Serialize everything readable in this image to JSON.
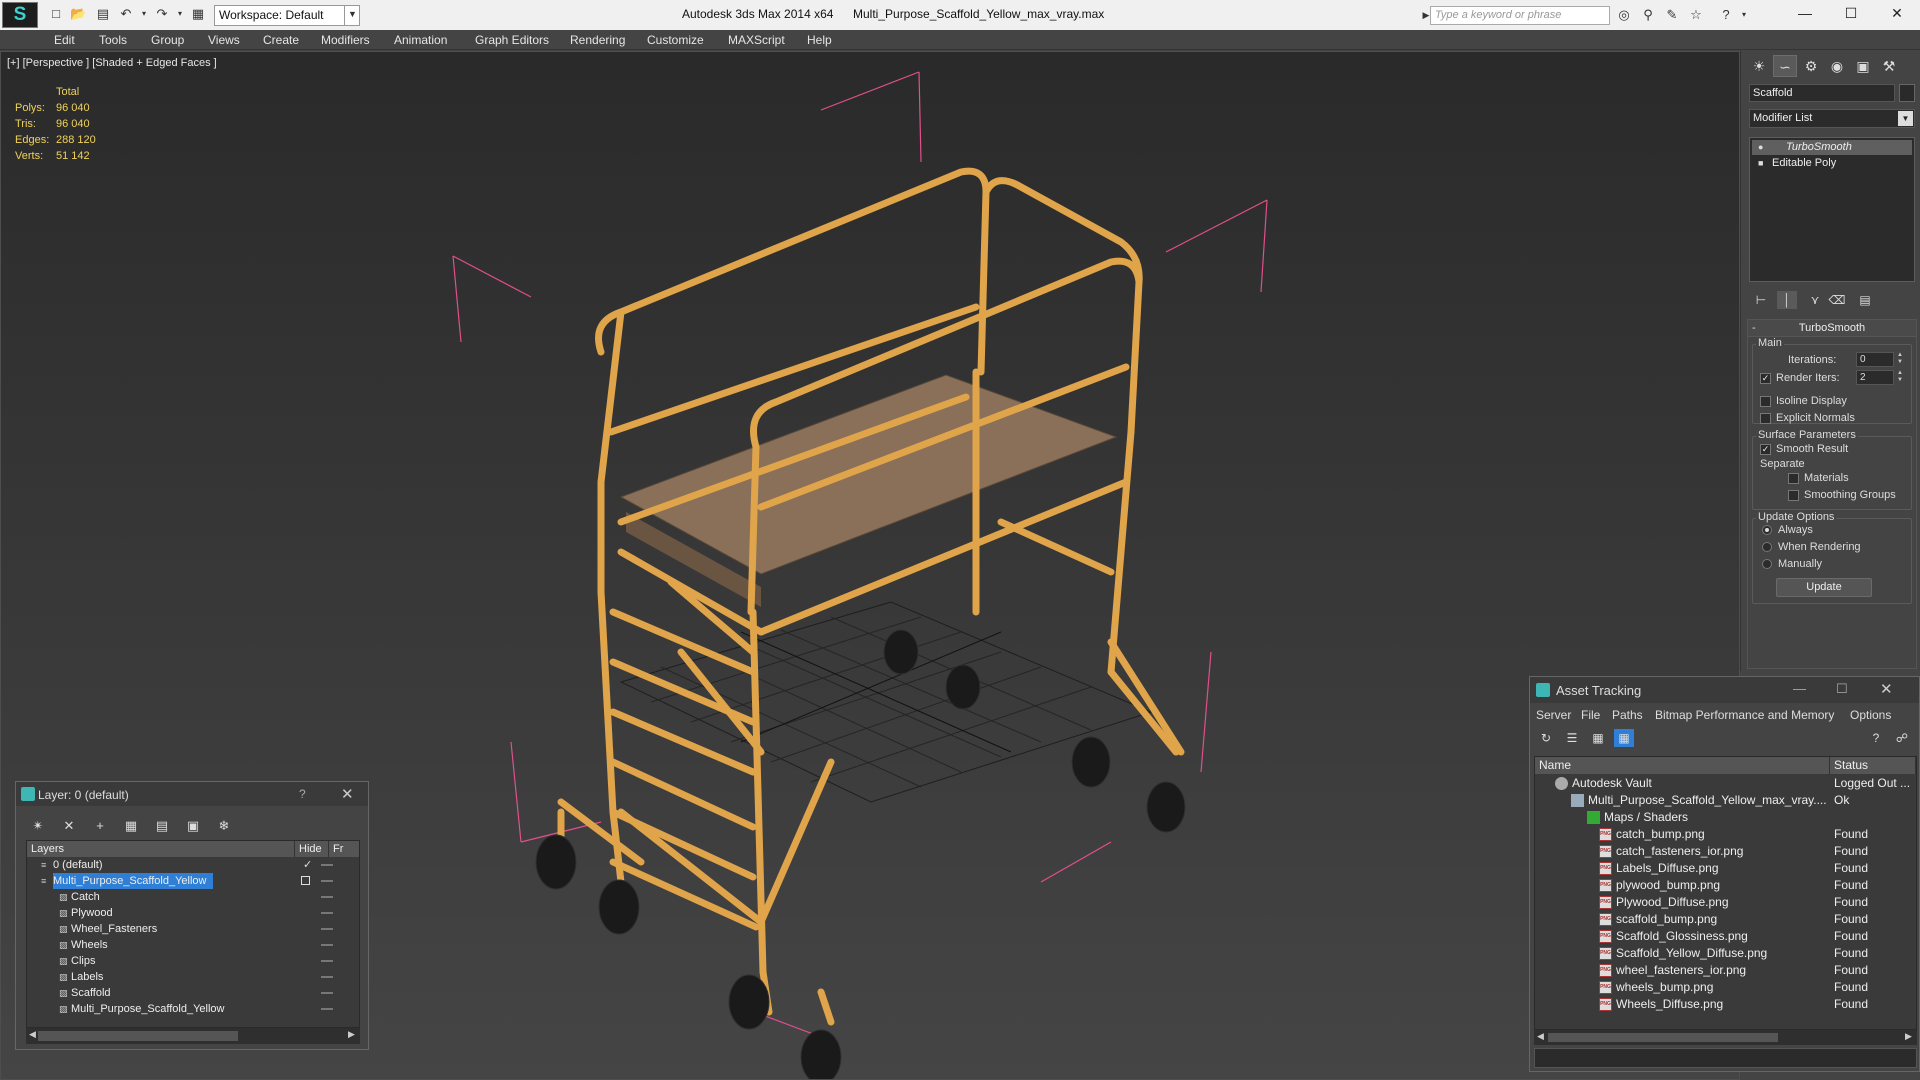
{
  "titlebar": {
    "workspace_label": "Workspace: Default",
    "app_title": "Autodesk 3ds Max  2014 x64",
    "file_title": "Multi_Purpose_Scaffold_Yellow_max_vray.max",
    "search_placeholder": "Type a keyword or phrase"
  },
  "menu": [
    "Edit",
    "Tools",
    "Group",
    "Views",
    "Create",
    "Modifiers",
    "Animation",
    "Graph Editors",
    "Rendering",
    "Customize",
    "MAXScript",
    "Help"
  ],
  "viewport": {
    "label": "[+] [Perspective ] [Shaded + Edged Faces ]",
    "stats_header": "Total",
    "stats": [
      {
        "label": "Polys:",
        "value": "96 040"
      },
      {
        "label": "Tris:",
        "value": "96 040"
      },
      {
        "label": "Edges:",
        "value": "288 120"
      },
      {
        "label": "Verts:",
        "value": "51 142"
      }
    ]
  },
  "command_panel": {
    "object_name": "Scaffold",
    "modifier_list": "Modifier List",
    "stack": [
      "TurboSmooth",
      "Editable Poly"
    ],
    "rollout_title": "TurboSmooth",
    "main_group": "Main",
    "iterations_label": "Iterations:",
    "iterations_value": "0",
    "render_iters_label": "Render Iters:",
    "render_iters_value": "2",
    "isoline_label": "Isoline Display",
    "explicit_normals_label": "Explicit Normals",
    "surface_group": "Surface Parameters",
    "smooth_result_label": "Smooth Result",
    "separate_label": "Separate",
    "materials_label": "Materials",
    "smoothing_groups_label": "Smoothing Groups",
    "update_group": "Update Options",
    "update_always": "Always",
    "update_when_rendering": "When Rendering",
    "update_manually": "Manually",
    "update_button": "Update"
  },
  "layer_dialog": {
    "title": "Layer: 0 (default)",
    "help": "?",
    "columns": [
      "Layers",
      "Hide",
      "Fr"
    ],
    "rows": [
      {
        "name": "0 (default)",
        "indent": 1
      },
      {
        "name": "Multi_Purpose_Scaffold_Yellow",
        "indent": 1
      },
      {
        "name": "Catch",
        "indent": 2
      },
      {
        "name": "Plywood",
        "indent": 2
      },
      {
        "name": "Wheel_Fasteners",
        "indent": 2
      },
      {
        "name": "Wheels",
        "indent": 2
      },
      {
        "name": "Clips",
        "indent": 2
      },
      {
        "name": "Labels",
        "indent": 2
      },
      {
        "name": "Scaffold",
        "indent": 2
      },
      {
        "name": "Multi_Purpose_Scaffold_Yellow",
        "indent": 2
      }
    ]
  },
  "asset_tracking": {
    "title": "Asset Tracking",
    "menu": [
      "Server",
      "File",
      "Paths",
      "Bitmap Performance and Memory",
      "Options"
    ],
    "columns": [
      "Name",
      "Status"
    ],
    "rows": [
      {
        "name": "Autodesk Vault",
        "status": "Logged Out ...",
        "indent": 1
      },
      {
        "name": "Multi_Purpose_Scaffold_Yellow_max_vray....",
        "status": "Ok",
        "indent": 2
      },
      {
        "name": "Maps / Shaders",
        "status": "",
        "indent": 3
      },
      {
        "name": "catch_bump.png",
        "status": "Found",
        "indent": 4
      },
      {
        "name": "catch_fasteners_ior.png",
        "status": "Found",
        "indent": 4
      },
      {
        "name": "Labels_Diffuse.png",
        "status": "Found",
        "indent": 4
      },
      {
        "name": "plywood_bump.png",
        "status": "Found",
        "indent": 4
      },
      {
        "name": "Plywood_Diffuse.png",
        "status": "Found",
        "indent": 4
      },
      {
        "name": "scaffold_bump.png",
        "status": "Found",
        "indent": 4
      },
      {
        "name": "Scaffold_Glossiness.png",
        "status": "Found",
        "indent": 4
      },
      {
        "name": "Scaffold_Yellow_Diffuse.png",
        "status": "Found",
        "indent": 4
      },
      {
        "name": "wheel_fasteners_ior.png",
        "status": "Found",
        "indent": 4
      },
      {
        "name": "wheels_bump.png",
        "status": "Found",
        "indent": 4
      },
      {
        "name": "Wheels_Diffuse.png",
        "status": "Found",
        "indent": 4
      }
    ]
  },
  "colors": {
    "scaffold": "#e0a44a",
    "plywood": "#a08060",
    "selection": "#2f7fd6",
    "stats": "#f0d25a",
    "bbox": "#e0508a"
  }
}
